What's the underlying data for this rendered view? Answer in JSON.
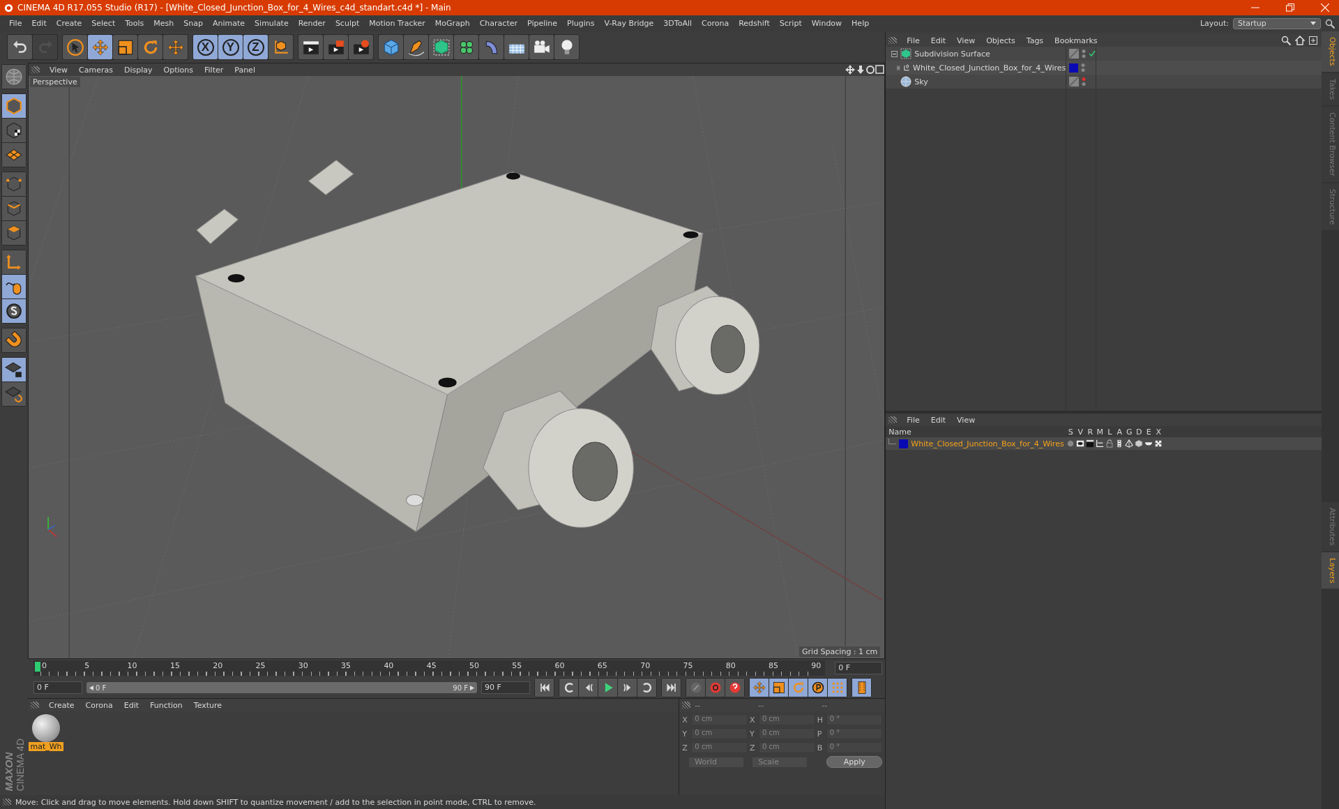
{
  "window": {
    "title": "CINEMA 4D R17.055 Studio (R17) - [White_Closed_Junction_Box_for_4_Wires_c4d_standart.c4d *] - Main"
  },
  "menu": [
    "File",
    "Edit",
    "Create",
    "Select",
    "Tools",
    "Mesh",
    "Snap",
    "Animate",
    "Simulate",
    "Render",
    "Sculpt",
    "Motion Tracker",
    "MoGraph",
    "Character",
    "Pipeline",
    "Plugins",
    "V-Ray Bridge",
    "3DToAll",
    "Corona",
    "Redshift",
    "Script",
    "Window",
    "Help"
  ],
  "layout": {
    "label": "Layout:",
    "value": "Startup"
  },
  "toolbar": [
    [
      {
        "kind": "undo",
        "selected": false,
        "disabled": false
      },
      {
        "kind": "redo",
        "selected": false,
        "disabled": true
      }
    ],
    [
      {
        "kind": "select",
        "selected": false,
        "disabled": false
      },
      {
        "kind": "move",
        "selected": true,
        "disabled": false
      },
      {
        "kind": "scale",
        "selected": false,
        "disabled": false
      },
      {
        "kind": "rotate",
        "selected": false,
        "disabled": false
      },
      {
        "kind": "transform",
        "selected": false,
        "disabled": false
      }
    ],
    [
      {
        "kind": "axis",
        "label": "X",
        "selected": true,
        "disabled": false
      },
      {
        "kind": "axis",
        "label": "Y",
        "selected": true,
        "disabled": false
      },
      {
        "kind": "axis",
        "label": "Z",
        "selected": true,
        "disabled": false
      },
      {
        "kind": "world",
        "selected": false,
        "disabled": false
      }
    ],
    [
      {
        "kind": "renderview",
        "selected": false,
        "disabled": false
      },
      {
        "kind": "render",
        "selected": false,
        "disabled": false
      },
      {
        "kind": "rendersettings",
        "selected": false,
        "disabled": false
      }
    ],
    [
      {
        "kind": "cube",
        "selected": false,
        "disabled": false
      },
      {
        "kind": "pen",
        "selected": false,
        "disabled": false
      },
      {
        "kind": "subdivision",
        "selected": false,
        "disabled": false
      },
      {
        "kind": "cloner",
        "selected": false,
        "disabled": false
      },
      {
        "kind": "deformer",
        "selected": false,
        "disabled": false
      },
      {
        "kind": "floor",
        "selected": false,
        "disabled": false
      },
      {
        "kind": "camera",
        "selected": false,
        "disabled": false
      },
      {
        "kind": "light",
        "selected": false,
        "disabled": false
      }
    ]
  ],
  "left_tools": [
    [
      {
        "kind": "solo",
        "selected": false
      }
    ],
    [
      {
        "kind": "model",
        "selected": true
      },
      {
        "kind": "texture",
        "selected": false
      },
      {
        "kind": "workplane",
        "selected": false
      }
    ],
    [
      {
        "kind": "points",
        "selected": false
      },
      {
        "kind": "edges",
        "selected": false
      },
      {
        "kind": "polygons",
        "selected": false
      }
    ],
    [
      {
        "kind": "axis",
        "selected": false
      },
      {
        "kind": "tweak",
        "selected": true
      },
      {
        "kind": "snap",
        "selected": true
      }
    ],
    [
      {
        "kind": "magnet",
        "selected": false
      }
    ],
    [
      {
        "kind": "lockplane",
        "selected": true
      },
      {
        "kind": "planar",
        "selected": false
      }
    ]
  ],
  "logo": {
    "line1": "MAXON",
    "line2": "CINEMA 4D"
  },
  "viewport": {
    "menu": [
      "View",
      "Cameras",
      "Display",
      "Options",
      "Filter",
      "Panel"
    ],
    "camera": "Perspective",
    "grid_spacing": "Grid Spacing : 1 cm"
  },
  "timeline": {
    "labels": [
      "0",
      "5",
      "10",
      "15",
      "20",
      "25",
      "30",
      "35",
      "40",
      "45",
      "50",
      "55",
      "60",
      "65",
      "70",
      "75",
      "80",
      "85",
      "90"
    ],
    "playhead": {
      "level": 0
    },
    "current_frame": "0 F"
  },
  "transport": {
    "start": "0 F",
    "range": {
      "start": "0 F",
      "end": "90 F",
      "level": 1
    },
    "end": "90 F",
    "buttons": [
      [
        {
          "kind": "first",
          "selected": false
        }
      ],
      [
        {
          "kind": "prevkey",
          "selected": false
        },
        {
          "kind": "prevframe",
          "selected": false
        },
        {
          "kind": "play",
          "selected": false
        },
        {
          "kind": "nextframe",
          "selected": false
        },
        {
          "kind": "nextkey",
          "selected": false
        }
      ],
      [
        {
          "kind": "last",
          "selected": false
        }
      ],
      [
        {
          "kind": "keyframe",
          "selected": false
        },
        {
          "kind": "record",
          "selected": false
        },
        {
          "kind": "autokey",
          "selected": false
        }
      ],
      [
        {
          "kind": "move",
          "selected": true
        },
        {
          "kind": "scale",
          "selected": true
        },
        {
          "kind": "rotate",
          "selected": true
        },
        {
          "kind": "param",
          "selected": true
        },
        {
          "kind": "pla",
          "selected": true
        }
      ],
      [
        {
          "kind": "film",
          "selected": true
        }
      ]
    ]
  },
  "materials": {
    "menu": [
      "Create",
      "Corona",
      "Edit",
      "Function",
      "Texture"
    ],
    "items": [
      {
        "name": "mat_Wh",
        "selected": true
      }
    ]
  },
  "coordinates": {
    "headers": [
      "--",
      "--",
      "--"
    ],
    "rows": [
      {
        "a": "X",
        "pos": "0 cm",
        "b": "X",
        "size": "0 cm",
        "c": "H",
        "rot": "0 °"
      },
      {
        "a": "Y",
        "pos": "0 cm",
        "b": "Y",
        "size": "0 cm",
        "c": "P",
        "rot": "0 °"
      },
      {
        "a": "Z",
        "pos": "0 cm",
        "b": "Z",
        "size": "0 cm",
        "c": "B",
        "rot": "0 °"
      }
    ],
    "dropdowns": [
      "World",
      "Scale"
    ],
    "apply": "Apply"
  },
  "status_bar": "Move: Click and drag to move elements. Hold down SHIFT to quantize movement / add to the selection in point mode, CTRL to remove.",
  "object_manager": {
    "menu": [
      "File",
      "Edit",
      "View",
      "Objects",
      "Tags",
      "Bookmarks"
    ],
    "objects": [
      {
        "name": "Subdivision Surface",
        "kind": "subdivision",
        "expanded": true,
        "enabled": true,
        "editor_visible": true,
        "children": [
          {
            "name": "White_Closed_Junction_Box_for_4_Wires",
            "kind": "null",
            "expanded": false,
            "color": "#0a0ab4",
            "editor_visible": true
          }
        ]
      },
      {
        "name": "Sky",
        "kind": "sky",
        "editor_visible": false
      }
    ]
  },
  "layer_manager": {
    "menu": [
      "File",
      "Edit",
      "View"
    ],
    "columns": [
      "Name",
      "S",
      "V",
      "R",
      "M",
      "L",
      "A",
      "G",
      "D",
      "E",
      "X"
    ],
    "layers": [
      {
        "name": "White_Closed_Junction_Box_for_4_Wires",
        "color": "#0a0ab4",
        "selected": true
      }
    ]
  },
  "side_tabs": {
    "top": [
      {
        "label": "Objects",
        "selected": true
      },
      {
        "label": "Takes",
        "selected": false
      },
      {
        "label": "Content Browser",
        "selected": false
      },
      {
        "label": "Structure",
        "selected": false
      }
    ],
    "bottom": [
      {
        "label": "Attributes",
        "selected": false
      },
      {
        "label": "Layers",
        "selected": true
      }
    ]
  }
}
